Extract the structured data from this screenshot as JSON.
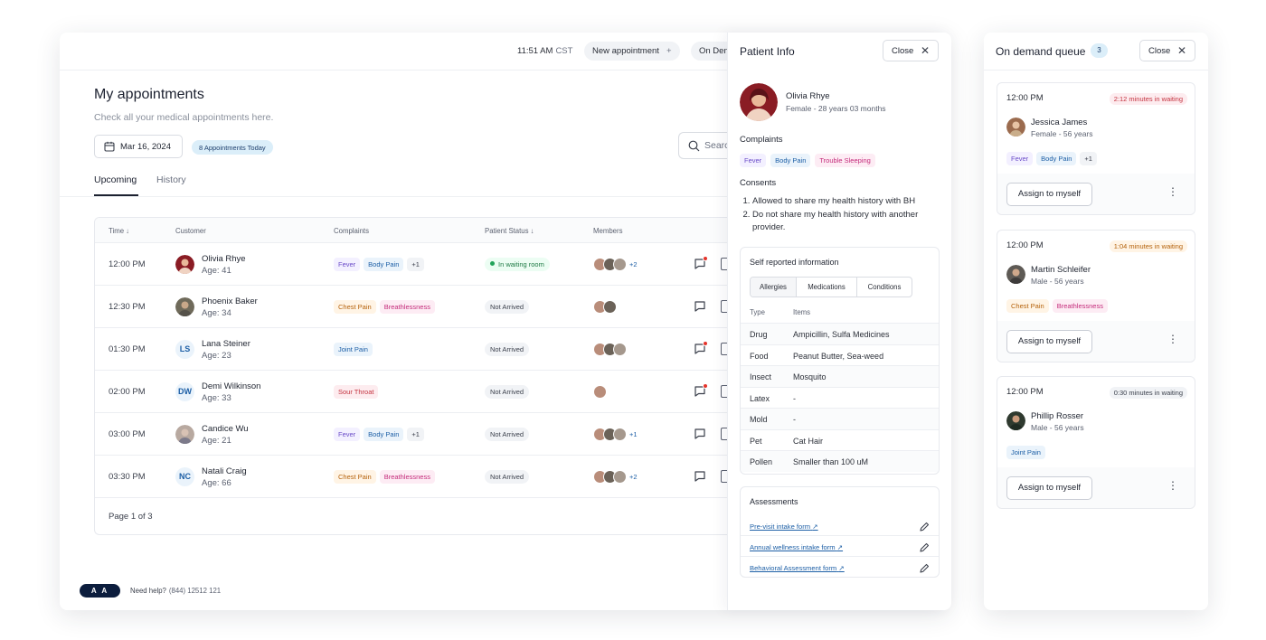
{
  "header": {
    "time": "11:51 AM",
    "timezone": "CST",
    "new_appointment": "New appointment",
    "on_demand": "On Demand"
  },
  "page": {
    "title": "My appointments",
    "subtitle": "Check all your medical appointments here.",
    "date": "Mar 16, 2024",
    "appointments_today": "8 Appointments Today",
    "search_placeholder": "Search"
  },
  "tabs": [
    {
      "label": "Upcoming",
      "active": true
    },
    {
      "label": "History",
      "active": false
    }
  ],
  "table": {
    "columns": [
      "Time",
      "Customer",
      "Complaints",
      "Patient Status",
      "Members"
    ],
    "rows": [
      {
        "time": "12:00 PM",
        "name": "Olivia Rhye",
        "age": "Age: 41",
        "avatar": "photo",
        "initials": "",
        "tags": [
          {
            "label": "Fever",
            "kind": "fever"
          },
          {
            "label": "Body Pain",
            "kind": "body"
          },
          {
            "label": "+1",
            "kind": "more"
          }
        ],
        "status": "In waiting room",
        "waiting": true,
        "members": 3,
        "members_more": "+2",
        "unread": true
      },
      {
        "time": "12:30 PM",
        "name": "Phoenix Baker",
        "age": "Age: 34",
        "avatar": "photo",
        "initials": "",
        "tags": [
          {
            "label": "Chest Pain",
            "kind": "chest"
          },
          {
            "label": "Breathlessness",
            "kind": "breath"
          }
        ],
        "status": "Not Arrived",
        "waiting": false,
        "members": 2,
        "members_more": "",
        "unread": false
      },
      {
        "time": "01:30 PM",
        "name": "Lana Steiner",
        "age": "Age: 23",
        "avatar": "initials",
        "initials": "LS",
        "tags": [
          {
            "label": "Joint Pain",
            "kind": "joint"
          }
        ],
        "status": "Not Arrived",
        "waiting": false,
        "members": 3,
        "members_more": "",
        "unread": true
      },
      {
        "time": "02:00 PM",
        "name": "Demi Wilkinson",
        "age": "Age: 33",
        "avatar": "initials",
        "initials": "DW",
        "tags": [
          {
            "label": "Sour Throat",
            "kind": "sour"
          }
        ],
        "status": "Not Arrived",
        "waiting": false,
        "members": 1,
        "members_more": "",
        "unread": true
      },
      {
        "time": "03:00 PM",
        "name": "Candice Wu",
        "age": "Age: 21",
        "avatar": "photo",
        "initials": "",
        "tags": [
          {
            "label": "Fever",
            "kind": "fever"
          },
          {
            "label": "Body Pain",
            "kind": "body"
          },
          {
            "label": "+1",
            "kind": "more"
          }
        ],
        "status": "Not Arrived",
        "waiting": false,
        "members": 3,
        "members_more": "+1",
        "unread": false
      },
      {
        "time": "03:30 PM",
        "name": "Natali Craig",
        "age": "Age: 66",
        "avatar": "initials",
        "initials": "NC",
        "tags": [
          {
            "label": "Chest Pain",
            "kind": "chest"
          },
          {
            "label": "Breathlessness",
            "kind": "breath"
          }
        ],
        "status": "Not Arrived",
        "waiting": false,
        "members": 3,
        "members_more": "+2",
        "unread": false
      }
    ],
    "pager": "Page 1 of 3"
  },
  "footer": {
    "font_toggle": "A A",
    "help_label": "Need help?",
    "help_phone": "(844) 12512 121"
  },
  "patient_info": {
    "title": "Patient Info",
    "close_label": "Close",
    "name": "Olivia Rhye",
    "meta": "Female - 28 years 03 months",
    "complaints_title": "Complaints",
    "complaints": [
      {
        "label": "Fever",
        "kind": "fever"
      },
      {
        "label": "Body Pain",
        "kind": "body"
      },
      {
        "label": "Trouble Sleeping",
        "kind": "sleep"
      }
    ],
    "consents_title": "Consents",
    "consents": [
      "Allowed to share my health history with BH",
      "Do not share my health history with another provider."
    ],
    "self_reported": {
      "title": "Self reported information",
      "tabs": [
        "Allergies",
        "Medications",
        "Conditions"
      ],
      "headers": [
        "Type",
        "Items"
      ],
      "rows": [
        {
          "type": "Drug",
          "items": "Ampicillin, Sulfa Medicines"
        },
        {
          "type": "Food",
          "items": "Peanut Butter, Sea-weed"
        },
        {
          "type": "Insect",
          "items": "Mosquito"
        },
        {
          "type": "Latex",
          "items": "-"
        },
        {
          "type": "Mold",
          "items": "-"
        },
        {
          "type": "Pet",
          "items": "Cat Hair"
        },
        {
          "type": "Pollen",
          "items": "Smaller than 100 uM"
        }
      ]
    },
    "assessments": {
      "title": "Assessments",
      "links": [
        "Pre-visit intake form",
        "Annual wellness intake form",
        "Behavioral Assessment form"
      ]
    }
  },
  "queue": {
    "title": "On demand queue",
    "count": "3",
    "close_label": "Close",
    "assign_label": "Assign to myself",
    "items": [
      {
        "time": "12:00 PM",
        "wait": "2:12 minutes in waiting",
        "wait_kind": "red",
        "name": "Jessica James",
        "meta": "Female - 56 years",
        "tags": [
          {
            "label": "Fever",
            "kind": "fever"
          },
          {
            "label": "Body Pain",
            "kind": "body"
          },
          {
            "label": "+1",
            "kind": "more"
          }
        ]
      },
      {
        "time": "12:00 PM",
        "wait": "1:04 minutes in waiting",
        "wait_kind": "orange",
        "name": "Martin Schleifer",
        "meta": "Male - 56 years",
        "tags": [
          {
            "label": "Chest Pain",
            "kind": "chest"
          },
          {
            "label": "Breathlessness",
            "kind": "breath"
          }
        ]
      },
      {
        "time": "12:00 PM",
        "wait": "0:30 minutes in waiting",
        "wait_kind": "gray",
        "name": "Phillip Rosser",
        "meta": "Male - 56 years",
        "tags": [
          {
            "label": "Joint Pain",
            "kind": "joint"
          }
        ]
      }
    ]
  },
  "colors": {
    "accent": "#1d5fa6",
    "navy": "#0c1d3d",
    "danger": "#e5332a",
    "success": "#22a35a"
  }
}
